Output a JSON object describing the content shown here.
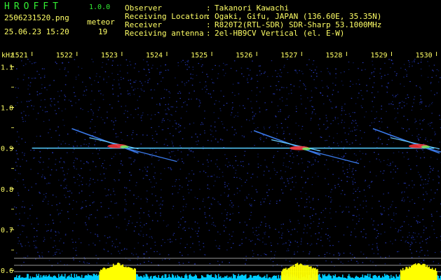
{
  "header": {
    "logo": "HROFFT",
    "version": "1.0.0",
    "filename": "2506231520.png",
    "timestamp": "25.06.23 15:20",
    "event_label": "meteor",
    "event_count": "19",
    "info": [
      {
        "label": "Observer",
        "sep": ":",
        "value": "Takanori Kawachi"
      },
      {
        "label": "Receiving Location",
        "sep": ":",
        "value": "Ogaki, Gifu, JAPAN (136.60E, 35.35N)"
      },
      {
        "label": "Receiver",
        "sep": ":",
        "value": "R820T2(RTL-SDR) SDR-Sharp 53.1000MHz"
      },
      {
        "label": "Receiving antenna",
        "sep": ":",
        "value": "2el-HB9CV Vertical (el. E-W)"
      }
    ]
  },
  "axes": {
    "y_unit": "kHz",
    "x_ticks": [
      "1521",
      "1522",
      "1523",
      "1524",
      "1525",
      "1526",
      "1527",
      "1528",
      "1529",
      "1530"
    ],
    "y_ticks": [
      "1.1",
      "1.0",
      "0.9",
      "0.8",
      "0.7",
      "0.6"
    ]
  },
  "colors": {
    "background": "#000000",
    "noise": "#1a2a8a",
    "header_text": "#ffff66",
    "logo": "#33ee33",
    "carrier": "#55ccff",
    "meteor_core": "#ff3333",
    "level_cyan": "#00ccff",
    "level_peak": "#ffff00"
  },
  "chart_data": {
    "type": "heatmap",
    "x_unit": "minute",
    "y_unit": "kHz",
    "xlim": [
      1520.6,
      1530.1
    ],
    "ylim": [
      0.59,
      1.14
    ],
    "carrier_freq": 0.9,
    "meteor_echoes": [
      {
        "time": 1522.9,
        "freq": 0.905
      },
      {
        "time": 1526.95,
        "freq": 0.9
      },
      {
        "time": 1529.6,
        "freq": 0.905
      }
    ],
    "event_count": 19
  }
}
